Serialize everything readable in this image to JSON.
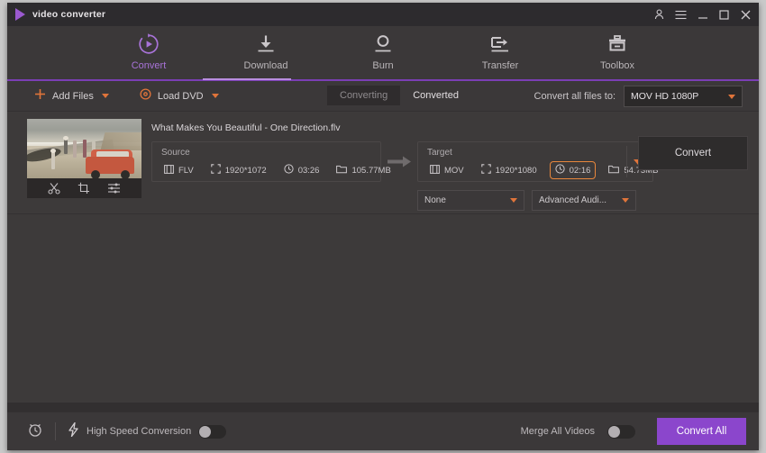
{
  "window": {
    "app_title": "video converter",
    "logo_icon": "play-triangle-icon",
    "controls": [
      {
        "name": "account-icon",
        "glyph": "person"
      },
      {
        "name": "menu-icon",
        "glyph": "hamburger"
      },
      {
        "name": "minimize-icon",
        "glyph": "minimize"
      },
      {
        "name": "maximize-icon",
        "glyph": "maximize"
      },
      {
        "name": "close-icon",
        "glyph": "close"
      }
    ]
  },
  "nav": {
    "tabs": [
      {
        "label": "Convert",
        "icon": "convert-circle-arrow-icon",
        "active": true
      },
      {
        "label": "Download",
        "icon": "download-arrow-icon",
        "active": false
      },
      {
        "label": "Burn",
        "icon": "burn-disc-icon",
        "active": false
      },
      {
        "label": "Transfer",
        "icon": "transfer-arrow-icon",
        "active": false
      },
      {
        "label": "Toolbox",
        "icon": "toolbox-icon",
        "active": false
      }
    ],
    "accent_color": "#7b3fb5",
    "active_color": "#a873d8"
  },
  "toolbar": {
    "add_files_label": "Add Files",
    "add_files_icon": "plus-icon",
    "load_dvd_label": "Load DVD",
    "load_dvd_icon": "disc-icon",
    "caret_icon": "caret-down-icon",
    "segments": [
      {
        "label": "Converting",
        "active": true
      },
      {
        "label": "Converted",
        "active": false
      }
    ],
    "convert_all_to_label": "Convert all files to:",
    "convert_all_to_value": "MOV HD 1080P",
    "accent_color": "#e0743a"
  },
  "file_row": {
    "file_name": "What Makes You Beautiful - One Direction.flv",
    "thumbnail_alt": "beach-scene-with-van-thumbnail",
    "thumb_tools": [
      {
        "name": "trim-scissors-icon",
        "label": "Trim"
      },
      {
        "name": "crop-icon",
        "label": "Crop"
      },
      {
        "name": "effects-sliders-icon",
        "label": "Effect"
      }
    ],
    "source": {
      "title": "Source",
      "format": "FLV",
      "resolution": "1920*1072",
      "duration": "03:26",
      "size": "105.77MB"
    },
    "target": {
      "title": "Target",
      "format": "MOV",
      "resolution": "1920*1080",
      "duration": "02:16",
      "size": "54.73MB",
      "duration_highlighted": true,
      "highlight_color": "#e8873c"
    },
    "arrow_icon": "right-arrow-icon",
    "subtitle_select": "None",
    "audio_select": "Advanced Audi...",
    "convert_label": "Convert"
  },
  "bottom": {
    "schedule_icon": "alarm-clock-icon",
    "speed_icon": "lightning-bolt-icon",
    "high_speed_label": "High Speed Conversion",
    "high_speed_on": false,
    "merge_label": "Merge All Videos",
    "merge_on": false,
    "convert_all_label": "Convert All",
    "convert_all_color": "#8b46cc"
  }
}
